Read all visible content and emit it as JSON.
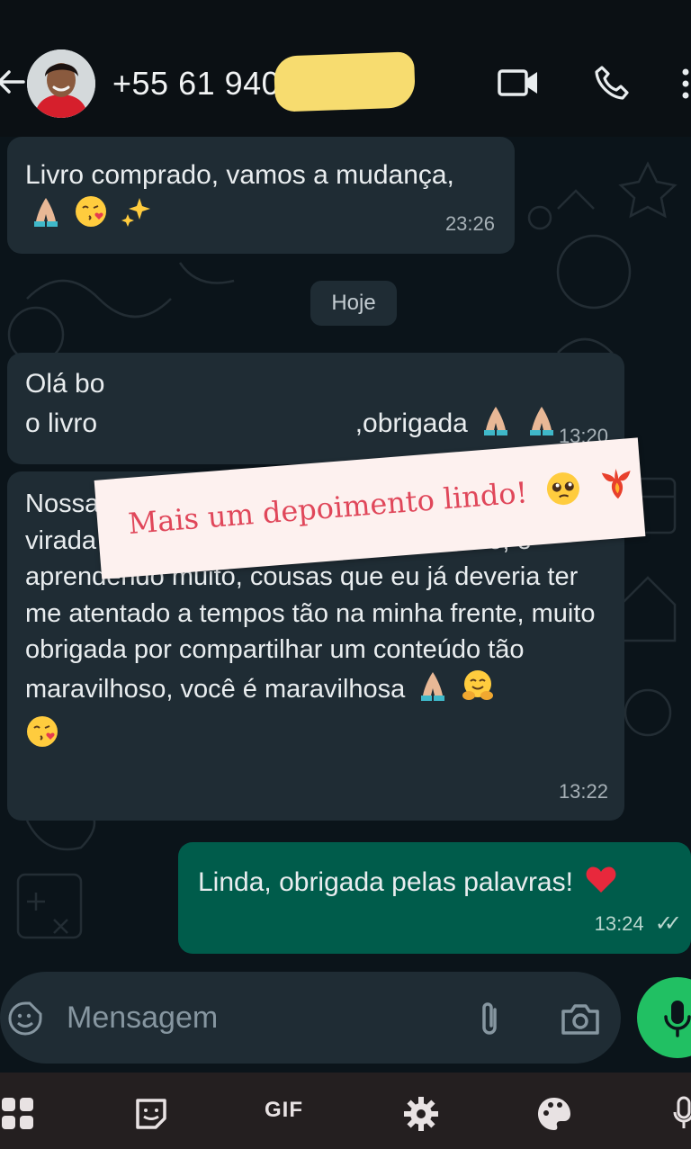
{
  "header": {
    "back_icon": "arrow-left-icon",
    "contact_number": "+55 61 9404-",
    "video_icon": "video-camera-icon",
    "call_icon": "phone-icon",
    "menu_icon": "more-vert-icon"
  },
  "messages": [
    {
      "direction": "in",
      "text": "Livro comprado, vamos a mudança,",
      "emojis": [
        "folded-hands",
        "kissing-heart",
        "sparkles"
      ],
      "time": "23:26"
    },
    {
      "direction": "in",
      "text_line1": "Olá bo",
      "text_line2_start": "o livro",
      "text_line2_end": ",obrigada",
      "emojis": [
        "folded-hands",
        "folded-hands"
      ],
      "time": "13:20"
    },
    {
      "direction": "in",
      "text": "Nossa já estou lendo e maravilhoso, é cada virada de chave nossa, eu estou amando, e aprendendo muito, cousas que eu já deveria ter me atentado a tempos tão na minha frente, muito obrigada por compartilhar um conteúdo tão maravilhoso, você é maravilhosa",
      "emojis": [
        "folded-hands",
        "hugging-face",
        "kissing-heart"
      ],
      "time": "13:22"
    },
    {
      "direction": "out",
      "text": "Linda, obrigada pelas palavras!",
      "emojis": [
        "red-heart"
      ],
      "time": "13:24",
      "status": "read"
    }
  ],
  "date_divider": "Hoje",
  "overlay": {
    "text": "Mais um depoimento lindo!",
    "emojis": [
      "pleading-face",
      "phoenix"
    ],
    "color": "#e0475a",
    "background": "#fdf1ef"
  },
  "input": {
    "placeholder": "Mensagem",
    "value": ""
  },
  "keyboard": {
    "gif_label": "GIF"
  },
  "colors": {
    "incoming": "#1f2c34",
    "outgoing": "#005c4b",
    "background": "#0b141a",
    "mic": "#21c063",
    "highlight": "#f7dc6f"
  }
}
